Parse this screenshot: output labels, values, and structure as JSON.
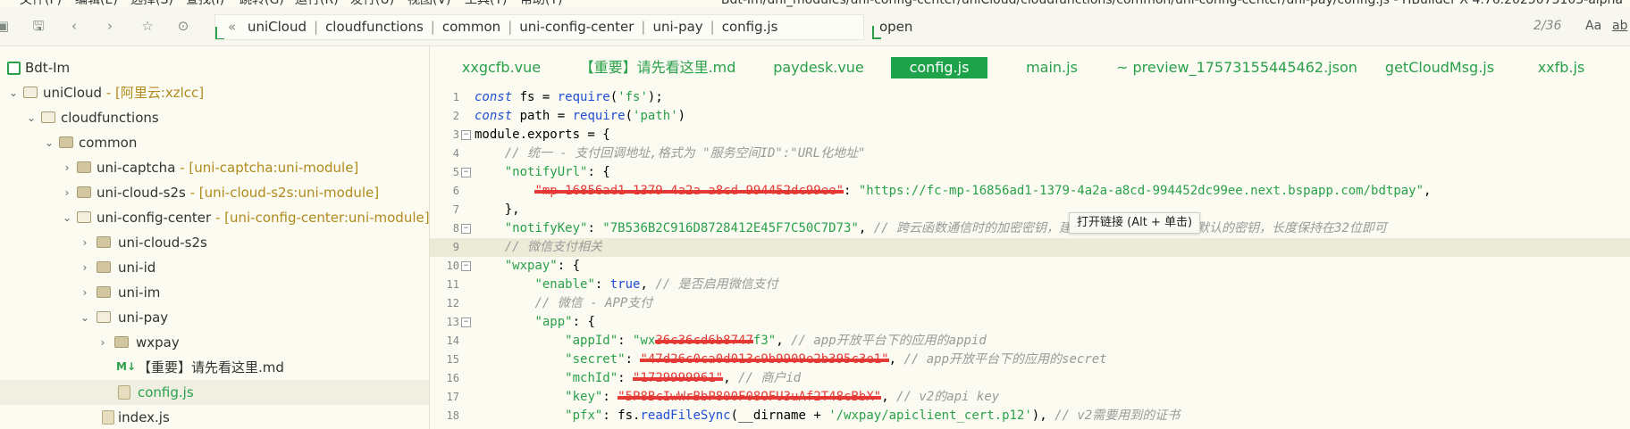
{
  "menubar": {
    "items": [
      "文件(F)",
      "编辑(E)",
      "选择(S)",
      "查找(I)",
      "跳转(G)",
      "运行(R)",
      "发行(U)",
      "视图(V)",
      "工具(T)",
      "帮助(Y)"
    ],
    "window_title": "Bdt-Im/uni_modules/uni-config-center/uniCloud/cloudfunctions/common/uni-config-center/uni-pay/config.js - HBuilder X 4.76.2025073103-alpha"
  },
  "toolbar": {
    "breadcrumbs": [
      "uniCloud",
      "cloudfunctions",
      "common",
      "uni-config-center",
      "uni-pay",
      "config.js"
    ],
    "find_value": "open",
    "find_count": "2/36",
    "find_case": "Aa",
    "find_word": "ab"
  },
  "sidebar": {
    "items": [
      {
        "label": "Bdt-Im",
        "suffix": ""
      },
      {
        "label": "uniCloud",
        "suffix": " - [阿里云:xzlcc]"
      },
      {
        "label": "cloudfunctions",
        "suffix": ""
      },
      {
        "label": "common",
        "suffix": ""
      },
      {
        "label": "uni-captcha",
        "suffix": " - [uni-captcha:uni-module]"
      },
      {
        "label": "uni-cloud-s2s",
        "suffix": " - [uni-cloud-s2s:uni-module]"
      },
      {
        "label": "uni-config-center",
        "suffix": " - [uni-config-center:uni-module]"
      },
      {
        "label": "uni-cloud-s2s",
        "suffix": ""
      },
      {
        "label": "uni-id",
        "suffix": ""
      },
      {
        "label": "uni-im",
        "suffix": ""
      },
      {
        "label": "uni-pay",
        "suffix": ""
      },
      {
        "label": "wxpay",
        "suffix": ""
      },
      {
        "label": "【重要】请先看这里.md",
        "suffix": ""
      },
      {
        "label": "config.js",
        "suffix": ""
      },
      {
        "label": "index.js",
        "suffix": ""
      }
    ]
  },
  "tabs": [
    "xxgcfb.vue",
    "【重要】请先看这里.md",
    "paydesk.vue",
    "config.js",
    "main.js",
    "~ preview_17573155445462.json",
    "getCloudMsg.js",
    "xxfb.js"
  ],
  "editor": {
    "lines": [
      {
        "n": "1",
        "t": [
          [
            "kw",
            "const"
          ],
          [
            "p",
            " fs = "
          ],
          [
            "fn",
            "require"
          ],
          [
            "p",
            "("
          ],
          [
            "str",
            "'fs'"
          ],
          [
            "p",
            ");"
          ]
        ]
      },
      {
        "n": "2",
        "t": [
          [
            "kw",
            "const"
          ],
          [
            "p",
            " path = "
          ],
          [
            "fn",
            "require"
          ],
          [
            "p",
            "("
          ],
          [
            "str",
            "'path'"
          ],
          [
            "p",
            ")"
          ]
        ]
      },
      {
        "n": "3",
        "t": [
          [
            "p",
            "module.exports = {"
          ]
        ]
      },
      {
        "n": "4",
        "t": [
          [
            "g",
            "    "
          ],
          [
            "cm",
            "// 统一 - 支付回调地址,格式为 \"服务空间ID\":\"URL化地址\""
          ]
        ]
      },
      {
        "n": "5",
        "t": [
          [
            "g",
            "    "
          ],
          [
            "key",
            "\"notifyUrl\""
          ],
          [
            "p",
            ": {"
          ]
        ]
      },
      {
        "n": "6",
        "t": [
          [
            "g",
            "        "
          ],
          [
            "red",
            "\"mp-16856ad1-1379-4a2a-a8cd-994452dc99ee\""
          ],
          [
            "p",
            ": "
          ],
          [
            "str",
            "\"https://fc-mp-16856ad1-1379-4a2a-a8cd-994452dc99ee.next.bspapp.com/bdtpay\""
          ],
          [
            "p",
            ","
          ]
        ]
      },
      {
        "n": "7",
        "t": [
          [
            "g",
            "    "
          ],
          [
            "p",
            "},"
          ]
        ]
      },
      {
        "n": "8",
        "t": [
          [
            "g",
            "    "
          ],
          [
            "key",
            "\"notifyKey\""
          ],
          [
            "p",
            ": "
          ],
          [
            "str",
            "\"7B536B2C916D8728412E45F7C50C7D73\""
          ],
          [
            "p",
            ", "
          ],
          [
            "cm",
            "// 跨云函数通信时的加密密钥，建议手动改下，不要使用默认的密钥，长度保持在32位即可"
          ]
        ]
      },
      {
        "n": "9",
        "t": [
          [
            "g",
            "    "
          ],
          [
            "cm",
            "// 微信支付相关"
          ]
        ]
      },
      {
        "n": "10",
        "t": [
          [
            "g",
            "    "
          ],
          [
            "key",
            "\"wxpay\""
          ],
          [
            "p",
            ": {"
          ]
        ]
      },
      {
        "n": "11",
        "t": [
          [
            "g",
            "        "
          ],
          [
            "key",
            "\"enable\""
          ],
          [
            "p",
            ": "
          ],
          [
            "bool",
            "true"
          ],
          [
            "p",
            ", "
          ],
          [
            "cm",
            "// 是否启用微信支付"
          ]
        ]
      },
      {
        "n": "12",
        "t": [
          [
            "g",
            "        "
          ],
          [
            "cm",
            "// 微信 - APP支付"
          ]
        ]
      },
      {
        "n": "13",
        "t": [
          [
            "g",
            "        "
          ],
          [
            "key",
            "\"app\""
          ],
          [
            "p",
            ": {"
          ]
        ]
      },
      {
        "n": "14",
        "t": [
          [
            "g",
            "            "
          ],
          [
            "key",
            "\"appId\""
          ],
          [
            "p",
            ": "
          ],
          [
            "str",
            "\"wx"
          ],
          [
            "red",
            "36c36cd6b8747"
          ],
          [
            "str",
            "f3\""
          ],
          [
            "p",
            ", "
          ],
          [
            "cm",
            "// app开放平台下的应用的appid"
          ]
        ]
      },
      {
        "n": "15",
        "t": [
          [
            "g",
            "            "
          ],
          [
            "key",
            "\"secret\""
          ],
          [
            "p",
            ": "
          ],
          [
            "red",
            "\"47d26c0ca0d013c9b9909e2b395c3e1\""
          ],
          [
            "p",
            ", "
          ],
          [
            "cm",
            "// app开放平台下的应用的secret"
          ]
        ]
      },
      {
        "n": "16",
        "t": [
          [
            "g",
            "            "
          ],
          [
            "key",
            "\"mchId\""
          ],
          [
            "p",
            ": "
          ],
          [
            "red",
            "\"1729999961\""
          ],
          [
            "p",
            ", "
          ],
          [
            "cm",
            "// 商户id"
          ]
        ]
      },
      {
        "n": "17",
        "t": [
          [
            "g",
            "            "
          ],
          [
            "key",
            "\"key\""
          ],
          [
            "p",
            ": "
          ],
          [
            "red",
            "\"5P8BcIwWrBbP800F08OFU3uAf2T48cBbX\""
          ],
          [
            "p",
            ", "
          ],
          [
            "cm",
            "// v2的api key"
          ]
        ]
      },
      {
        "n": "18",
        "t": [
          [
            "g",
            "            "
          ],
          [
            "key",
            "\"pfx\""
          ],
          [
            "p",
            ": fs."
          ],
          [
            "fn",
            "readFileSync"
          ],
          [
            "p",
            "(__dirname + "
          ],
          [
            "str",
            "'/wxpay/apiclient_cert.p12'"
          ],
          [
            "p",
            "), "
          ],
          [
            "cm",
            "// v2需要用到的证书"
          ]
        ]
      }
    ]
  },
  "tooltip": {
    "text": "打开链接 (Alt + 单击)"
  }
}
